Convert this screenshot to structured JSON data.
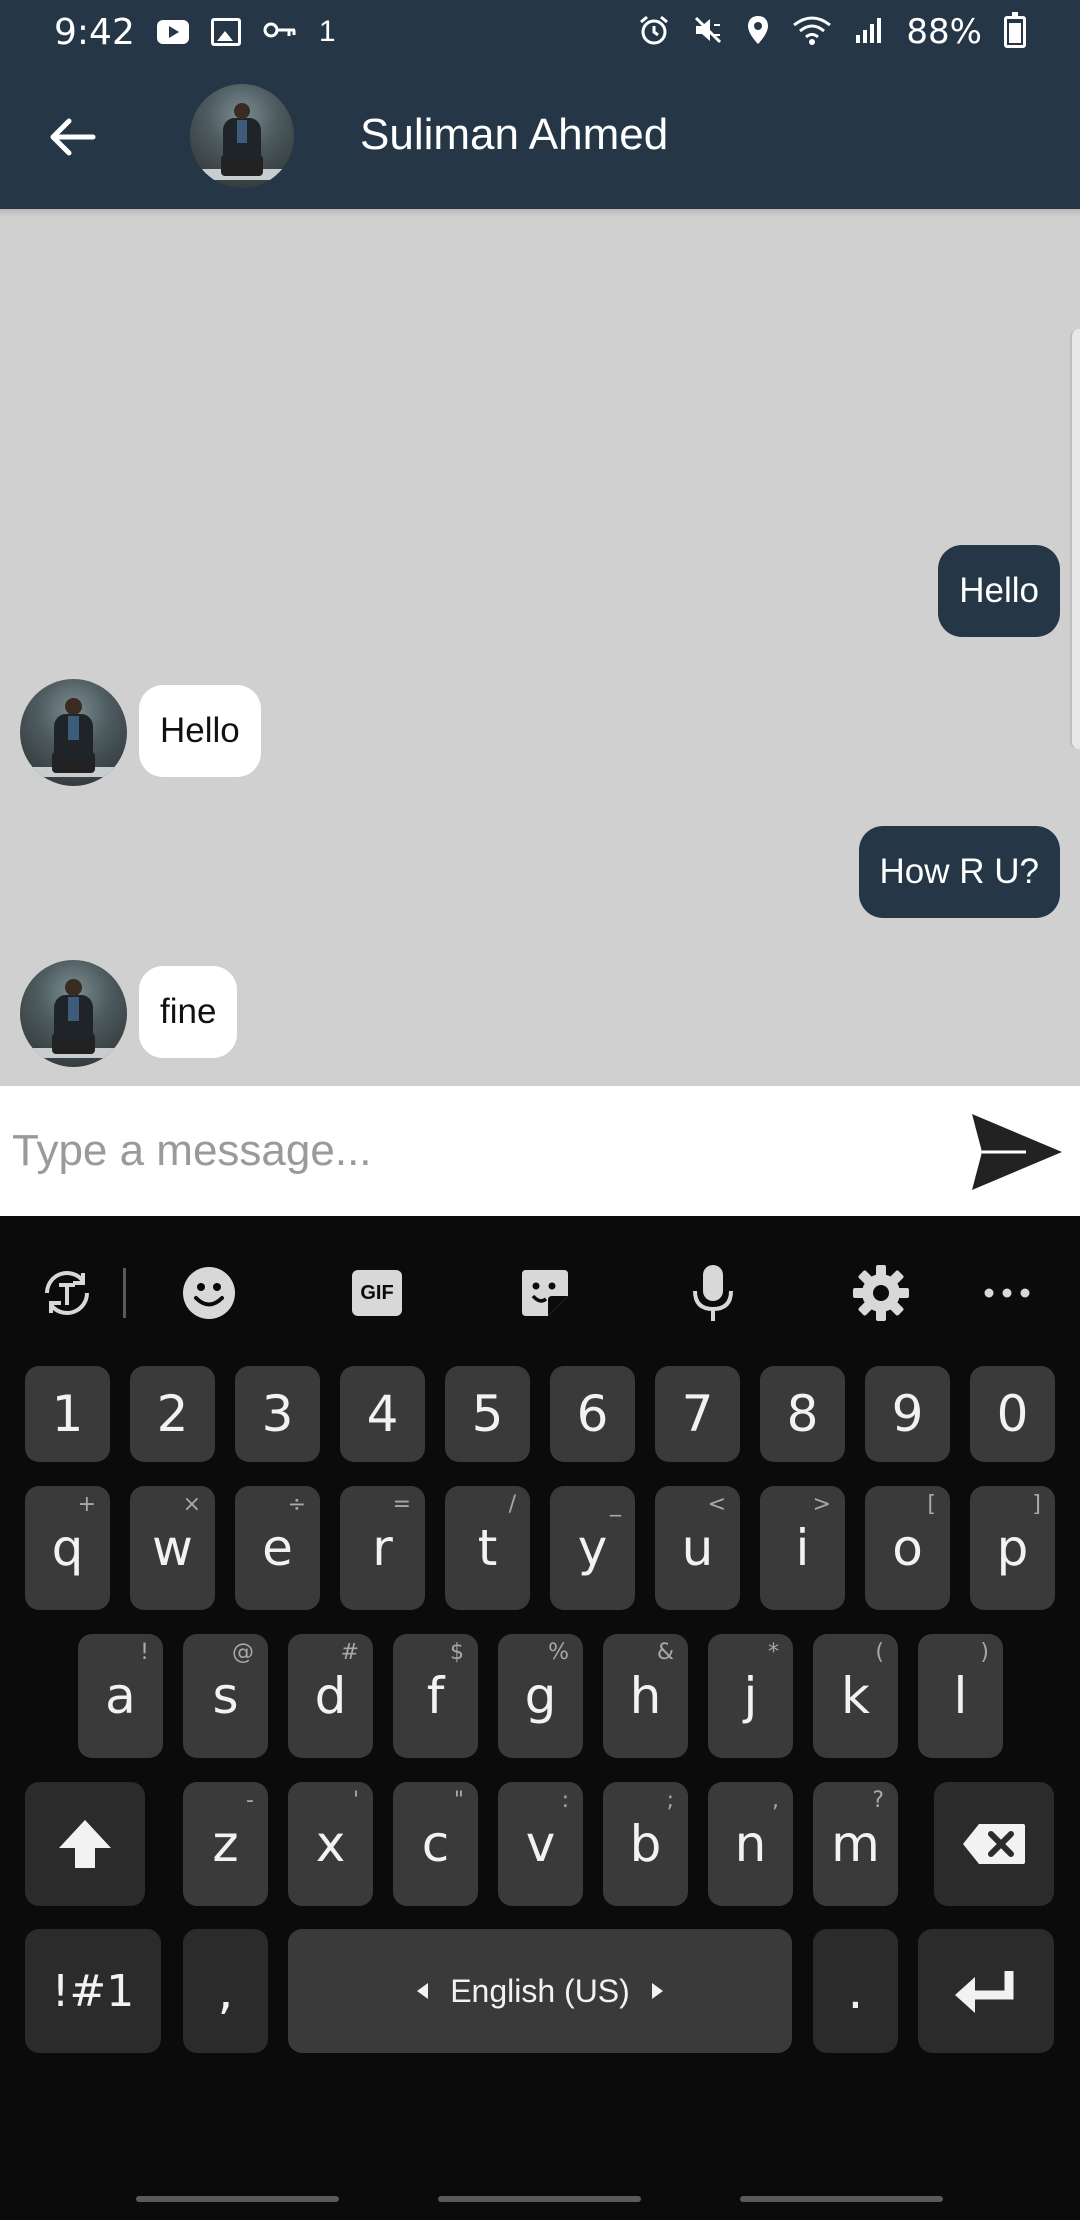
{
  "status_bar": {
    "time": "9:42",
    "sim_indicator": "1",
    "battery": "88%",
    "icons": [
      "youtube-icon",
      "image-icon",
      "vpn-key-icon",
      "alarm-icon",
      "mute-icon",
      "location-icon",
      "wifi-icon",
      "signal-icon",
      "battery-charging-icon"
    ]
  },
  "app_bar": {
    "contact_name": "Suliman Ahmed",
    "back_icon": "arrow-left-icon"
  },
  "messages": [
    {
      "direction": "outgoing",
      "text": "Hello"
    },
    {
      "direction": "incoming",
      "text": "Hello"
    },
    {
      "direction": "outgoing",
      "text": "How R U?"
    },
    {
      "direction": "incoming",
      "text": "fine"
    }
  ],
  "composer": {
    "placeholder": "Type a message...",
    "value": "",
    "send_icon": "send-icon"
  },
  "keyboard": {
    "toolbar": [
      "translate-icon",
      "emoji-icon",
      "gif-icon",
      "sticker-icon",
      "mic-icon",
      "settings-icon",
      "more-icon"
    ],
    "gif_label": "GIF",
    "number_row": [
      "1",
      "2",
      "3",
      "4",
      "5",
      "6",
      "7",
      "8",
      "9",
      "0"
    ],
    "row1": [
      {
        "key": "q",
        "hint": "+"
      },
      {
        "key": "w",
        "hint": "×"
      },
      {
        "key": "e",
        "hint": "÷"
      },
      {
        "key": "r",
        "hint": "="
      },
      {
        "key": "t",
        "hint": "/"
      },
      {
        "key": "y",
        "hint": "_"
      },
      {
        "key": "u",
        "hint": "<"
      },
      {
        "key": "i",
        "hint": ">"
      },
      {
        "key": "o",
        "hint": "["
      },
      {
        "key": "p",
        "hint": "]"
      }
    ],
    "row2": [
      {
        "key": "a",
        "hint": "!"
      },
      {
        "key": "s",
        "hint": "@"
      },
      {
        "key": "d",
        "hint": "#"
      },
      {
        "key": "f",
        "hint": "$"
      },
      {
        "key": "g",
        "hint": "%"
      },
      {
        "key": "h",
        "hint": "&"
      },
      {
        "key": "j",
        "hint": "*"
      },
      {
        "key": "k",
        "hint": "("
      },
      {
        "key": "l",
        "hint": ")"
      }
    ],
    "row3": [
      {
        "key": "z",
        "hint": "-"
      },
      {
        "key": "x",
        "hint": "'"
      },
      {
        "key": "c",
        "hint": "\""
      },
      {
        "key": "v",
        "hint": ":"
      },
      {
        "key": "b",
        "hint": ";"
      },
      {
        "key": "n",
        "hint": ","
      },
      {
        "key": "m",
        "hint": "?"
      }
    ],
    "symbols_label": "!#1",
    "comma_label": ",",
    "space_label": "English (US)",
    "period_label": ".",
    "shift_icon": "shift-icon",
    "backspace_icon": "backspace-icon",
    "enter_icon": "enter-icon"
  },
  "colors": {
    "brand": "#253746",
    "chat_background": "#d0d0d0",
    "incoming_bubble": "#ffffff",
    "keyboard_background": "#0b0b0b",
    "key": "#3a3a3a"
  }
}
